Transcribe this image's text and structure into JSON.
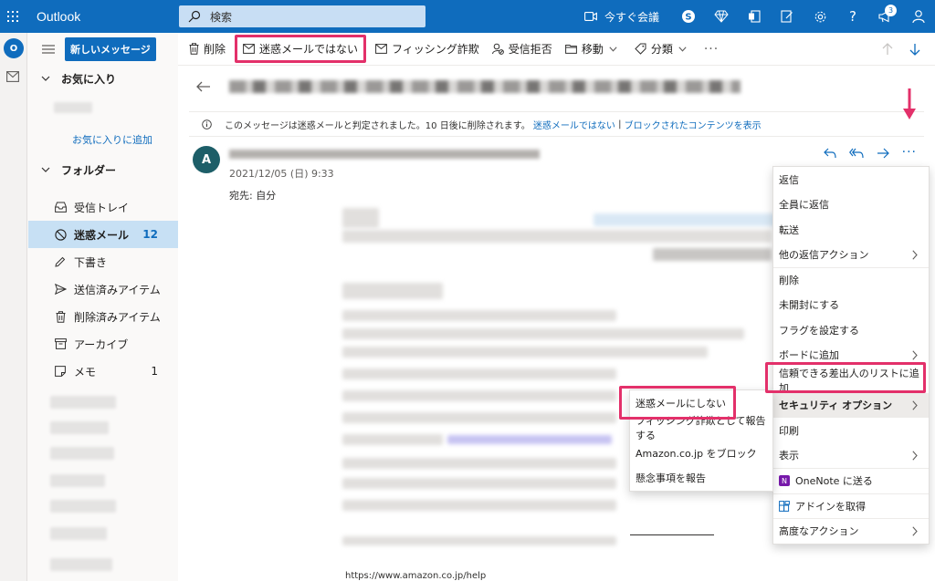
{
  "topbar": {
    "app_name": "Outlook",
    "search_placeholder": "検索",
    "meet_now": "今すぐ会議",
    "notification_count": "3",
    "colors": {
      "brand": "#0f6cbd"
    }
  },
  "nav": {
    "new_message": "新しいメッセージ",
    "favorites_header": "お気に入り",
    "add_favorite": "お気に入りに追加",
    "folders_header": "フォルダー",
    "folders": [
      {
        "label": "受信トレイ",
        "count": "",
        "icon": "inbox-icon"
      },
      {
        "label": "迷惑メール",
        "count": "12",
        "icon": "blocked-icon",
        "selected": true
      },
      {
        "label": "下書き",
        "count": "",
        "icon": "pencil-icon"
      },
      {
        "label": "送信済みアイテム",
        "count": "",
        "icon": "send-icon"
      },
      {
        "label": "削除済みアイテム",
        "count": "",
        "icon": "trash-icon"
      },
      {
        "label": "アーカイブ",
        "count": "",
        "icon": "archive-icon"
      },
      {
        "label": "メモ",
        "count": "1",
        "icon": "note-icon"
      }
    ]
  },
  "commands": {
    "delete": "削除",
    "not_junk": "迷惑メールではない",
    "phishing": "フィッシング詐欺",
    "block": "受信拒否",
    "move": "移動",
    "categorize": "分類",
    "more": "···"
  },
  "message": {
    "junk_notice": "このメッセージは迷惑メールと判定されました。10 日後に削除されます。",
    "not_junk_link": "迷惑メールではない",
    "separator": "|",
    "show_blocked_link": "ブロックされたコンテンツを表示",
    "avatar_initial": "A",
    "date": "2021/12/05 (日) 9:33",
    "to": "宛先:  自分",
    "help_url": "https://www.amazon.co.jp/help"
  },
  "menu": {
    "items": [
      {
        "label": "返信",
        "arrow": false
      },
      {
        "label": "全員に返信",
        "arrow": false
      },
      {
        "label": "転送",
        "arrow": false
      },
      {
        "label": "他の返信アクション",
        "arrow": true
      },
      {
        "label": "削除",
        "arrow": false,
        "sep": true
      },
      {
        "label": "未開封にする",
        "arrow": false
      },
      {
        "label": "フラグを設定する",
        "arrow": false
      },
      {
        "label": "ボードに追加",
        "arrow": true
      },
      {
        "label": "信頼できる差出人のリストに追加",
        "arrow": false,
        "highlight": true
      },
      {
        "label": "セキュリティ オプション",
        "arrow": true,
        "hover": true
      },
      {
        "label": "印刷",
        "arrow": false
      },
      {
        "label": "表示",
        "arrow": true
      },
      {
        "label": "OneNote に送る",
        "arrow": false,
        "icon": "onenote-icon",
        "sep": true
      },
      {
        "label": "アドインを取得",
        "arrow": false,
        "icon": "addin-icon",
        "sep": true
      },
      {
        "label": "高度なアクション",
        "arrow": true,
        "sep": true
      }
    ]
  },
  "submenu": {
    "items": [
      {
        "label": "迷惑メールにしない",
        "highlight": true
      },
      {
        "label": "フィッシング詐欺として報告する"
      },
      {
        "label": "Amazon.co.jp をブロック"
      },
      {
        "label": "懸念事項を報告"
      }
    ]
  },
  "highlight_color": "#e3306a"
}
